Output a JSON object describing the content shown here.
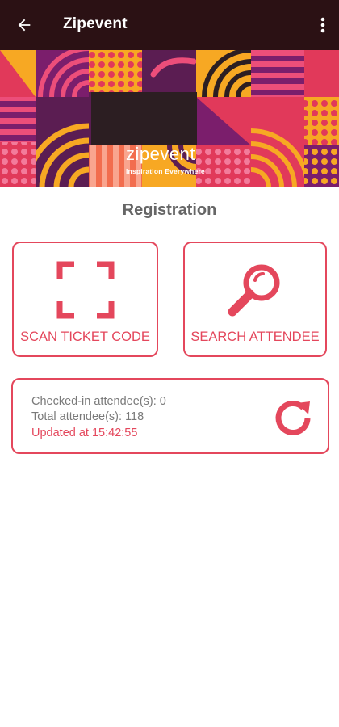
{
  "appbar": {
    "title": "Zipevent",
    "back_icon": "arrow-left-icon",
    "menu_icon": "more-vertical-icon"
  },
  "banner": {
    "brand_name": "zipevent",
    "tagline": "Inspiration Everywhere"
  },
  "registration": {
    "title": "Registration",
    "scan_label": "SCAN TICKET CODE",
    "search_label": "SEARCH ATTENDEE"
  },
  "stats": {
    "checked_in": "Checked-in attendee(s): 0",
    "total": "Total attendee(s): 118",
    "updated": "Updated at 15:42:55"
  },
  "colors": {
    "appbar_bg": "#2b1114",
    "accent": "#e4475c",
    "muted_text": "#7a7a7a",
    "title_text": "#666666"
  }
}
